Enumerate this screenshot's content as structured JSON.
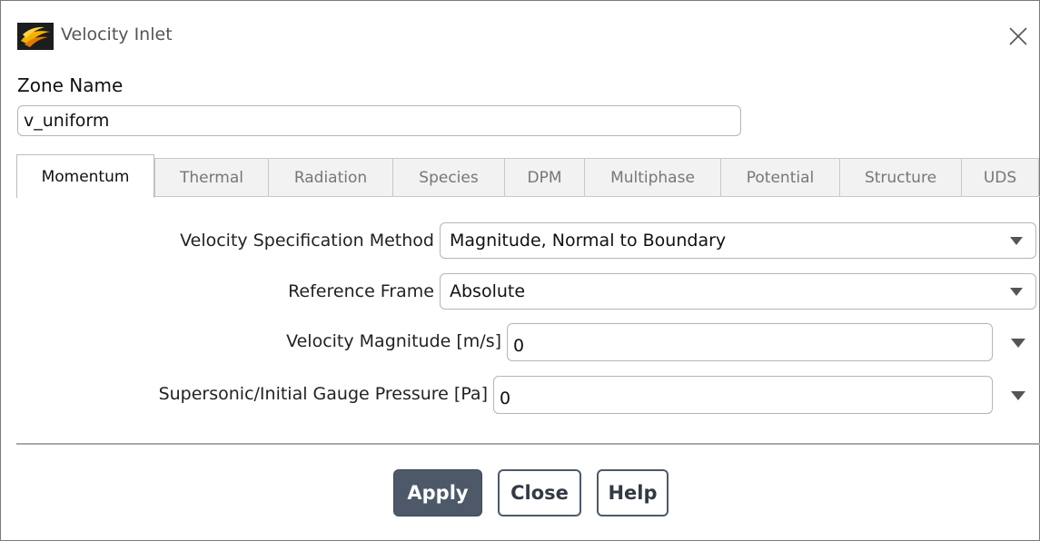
{
  "window": {
    "title": "Velocity Inlet",
    "icon": "fluent-app-icon",
    "close_icon": "close-icon"
  },
  "zone": {
    "label": "Zone Name",
    "value": "v_uniform"
  },
  "tabs": [
    {
      "label": "Momentum",
      "active": true
    },
    {
      "label": "Thermal",
      "active": false
    },
    {
      "label": "Radiation",
      "active": false
    },
    {
      "label": "Species",
      "active": false
    },
    {
      "label": "DPM",
      "active": false
    },
    {
      "label": "Multiphase",
      "active": false
    },
    {
      "label": "Potential",
      "active": false
    },
    {
      "label": "Structure",
      "active": false
    },
    {
      "label": "UDS",
      "active": false
    }
  ],
  "momentum": {
    "velocity_method": {
      "label": "Velocity Specification Method",
      "value": "Magnitude, Normal to Boundary"
    },
    "reference_frame": {
      "label": "Reference Frame",
      "value": "Absolute"
    },
    "velocity_magnitude": {
      "label": "Velocity Magnitude [m/s]",
      "value": "0"
    },
    "gauge_pressure": {
      "label": "Supersonic/Initial Gauge Pressure [Pa]",
      "value": "0"
    }
  },
  "buttons": {
    "apply": "Apply",
    "close": "Close",
    "help": "Help"
  },
  "colors": {
    "primary_button": "#4d5968",
    "border": "#b5b5b5",
    "tab_inactive_bg": "#f2f2f2"
  }
}
